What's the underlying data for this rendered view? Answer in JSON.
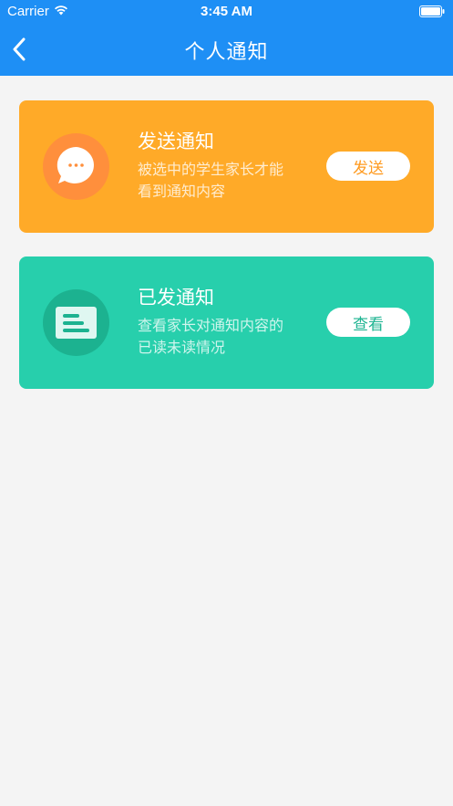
{
  "status_bar": {
    "carrier": "Carrier",
    "time": "3:45 AM"
  },
  "header": {
    "title": "个人通知",
    "back_icon": "chevron-left-icon"
  },
  "cards": [
    {
      "title": "发送通知",
      "description": "被选中的学生家长才能看到通知内容",
      "button_label": "发送",
      "icon": "chat-bubble-icon",
      "color": "#ffaa28"
    },
    {
      "title": "已发通知",
      "description": "查看家长对通知内容的已读未读情况",
      "button_label": "查看",
      "icon": "document-list-icon",
      "color": "#27cfac"
    }
  ],
  "colors": {
    "header": "#1e8ff5",
    "background": "#f4f4f4"
  }
}
